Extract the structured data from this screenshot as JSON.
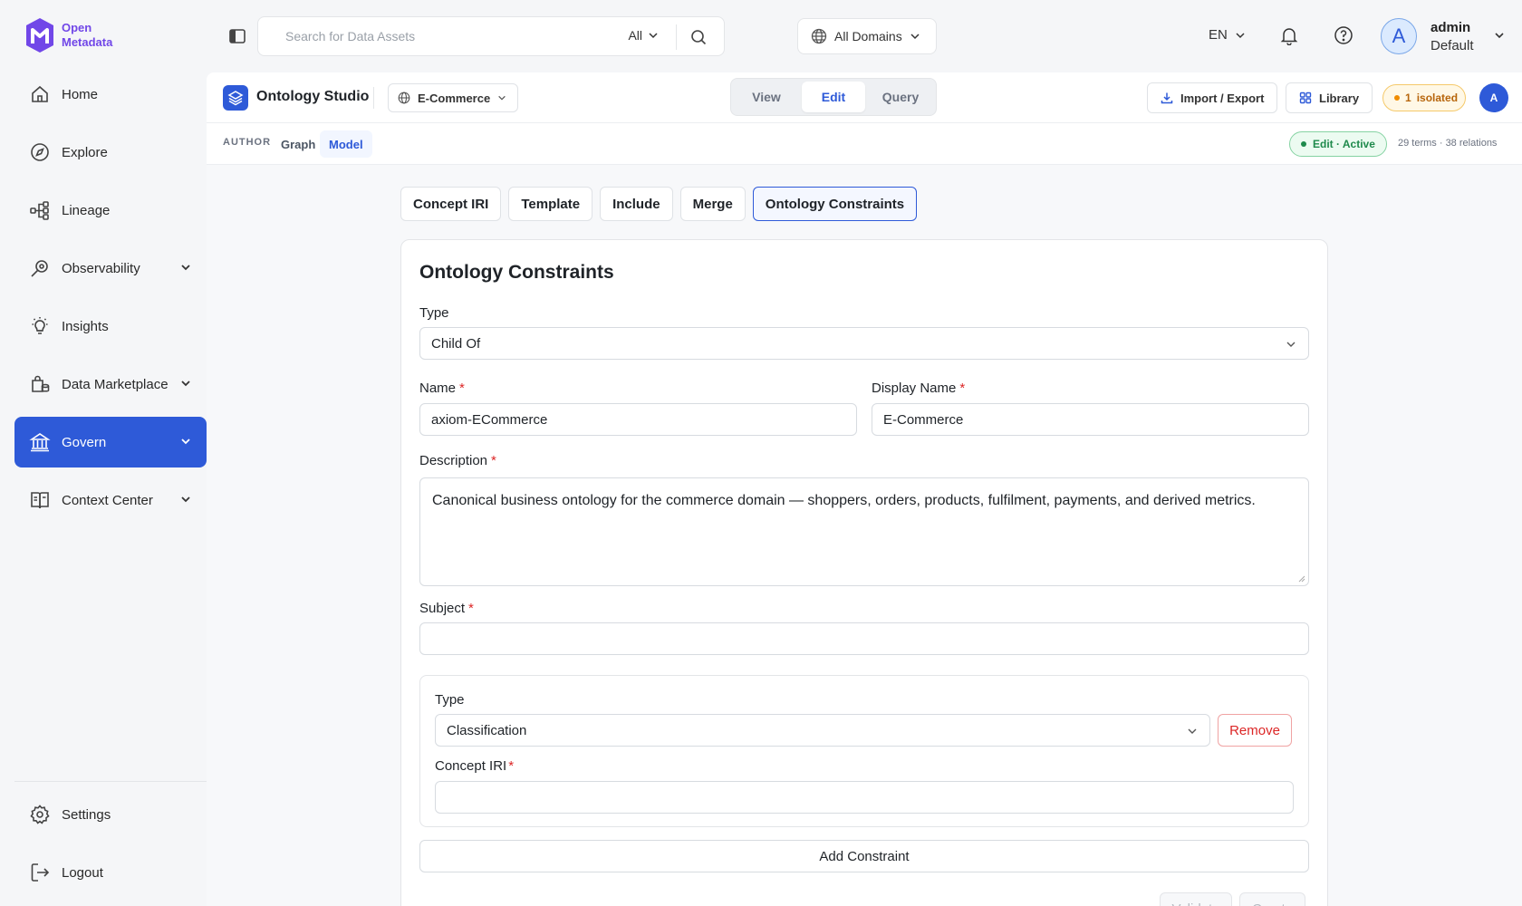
{
  "app": {
    "logo_line1": "Open",
    "logo_line2": "Metadata"
  },
  "sidebar": {
    "items": [
      {
        "label": "Home",
        "icon": "home-icon"
      },
      {
        "label": "Explore",
        "icon": "compass-icon"
      },
      {
        "label": "Lineage",
        "icon": "lineage-icon"
      },
      {
        "label": "Observability",
        "icon": "observability-icon",
        "expandable": true
      },
      {
        "label": "Insights",
        "icon": "lightbulb-icon"
      },
      {
        "label": "Data Marketplace",
        "icon": "marketplace-icon",
        "expandable": true
      },
      {
        "label": "Govern",
        "icon": "govern-icon",
        "expandable": true,
        "active": true
      },
      {
        "label": "Context Center",
        "icon": "book-icon",
        "expandable": true
      }
    ],
    "bottom": [
      {
        "label": "Settings",
        "icon": "gear-icon"
      },
      {
        "label": "Logout",
        "icon": "logout-icon"
      }
    ]
  },
  "topbar": {
    "search_placeholder": "Search for Data Assets",
    "search_scope": "All",
    "domains": "All Domains",
    "language": "EN",
    "user_initial": "A",
    "user_name": "admin",
    "user_role": "Default"
  },
  "studio": {
    "title": "Ontology Studio",
    "domain": "E-Commerce",
    "modes": [
      "View",
      "Edit",
      "Query"
    ],
    "active_mode": "Edit",
    "import_export": "Import / Export",
    "library": "Library",
    "isolated_count": "1",
    "isolated_label": "isolated",
    "avatar_initial": "A"
  },
  "subbar": {
    "label": "AUTHOR",
    "tabs": [
      "Graph",
      "Model"
    ],
    "active_tab": "Model",
    "status": "Edit · Active",
    "counts": "29 terms · 38 relations"
  },
  "constraint_tabs": [
    "Concept IRI",
    "Template",
    "Include",
    "Merge",
    "Ontology Constraints"
  ],
  "active_constraint_tab": "Ontology Constraints",
  "form": {
    "title": "Ontology Constraints",
    "type_label": "Type",
    "type_value": "Child Of",
    "name_label": "Name",
    "name_value": "axiom-ECommerce",
    "display_name_label": "Display Name",
    "display_name_value": "E-Commerce",
    "description_label": "Description",
    "description_value": "Canonical business ontology for the commerce domain — shoppers, orders, products, fulfilment, payments, and derived metrics.",
    "subject_label": "Subject",
    "subject_value": "",
    "constraint": {
      "type_label": "Type",
      "type_value": "Classification",
      "remove_label": "Remove",
      "concept_iri_label": "Concept IRI",
      "concept_iri_value": ""
    },
    "add_constraint_label": "Add Constraint",
    "validate_label": "Validate",
    "create_label": "Create"
  },
  "colors": {
    "brand": "#2e5ad8",
    "logo": "#7147e8",
    "danger": "#dc2626",
    "success": "#1f8a4c",
    "warning": "#b7650b"
  }
}
